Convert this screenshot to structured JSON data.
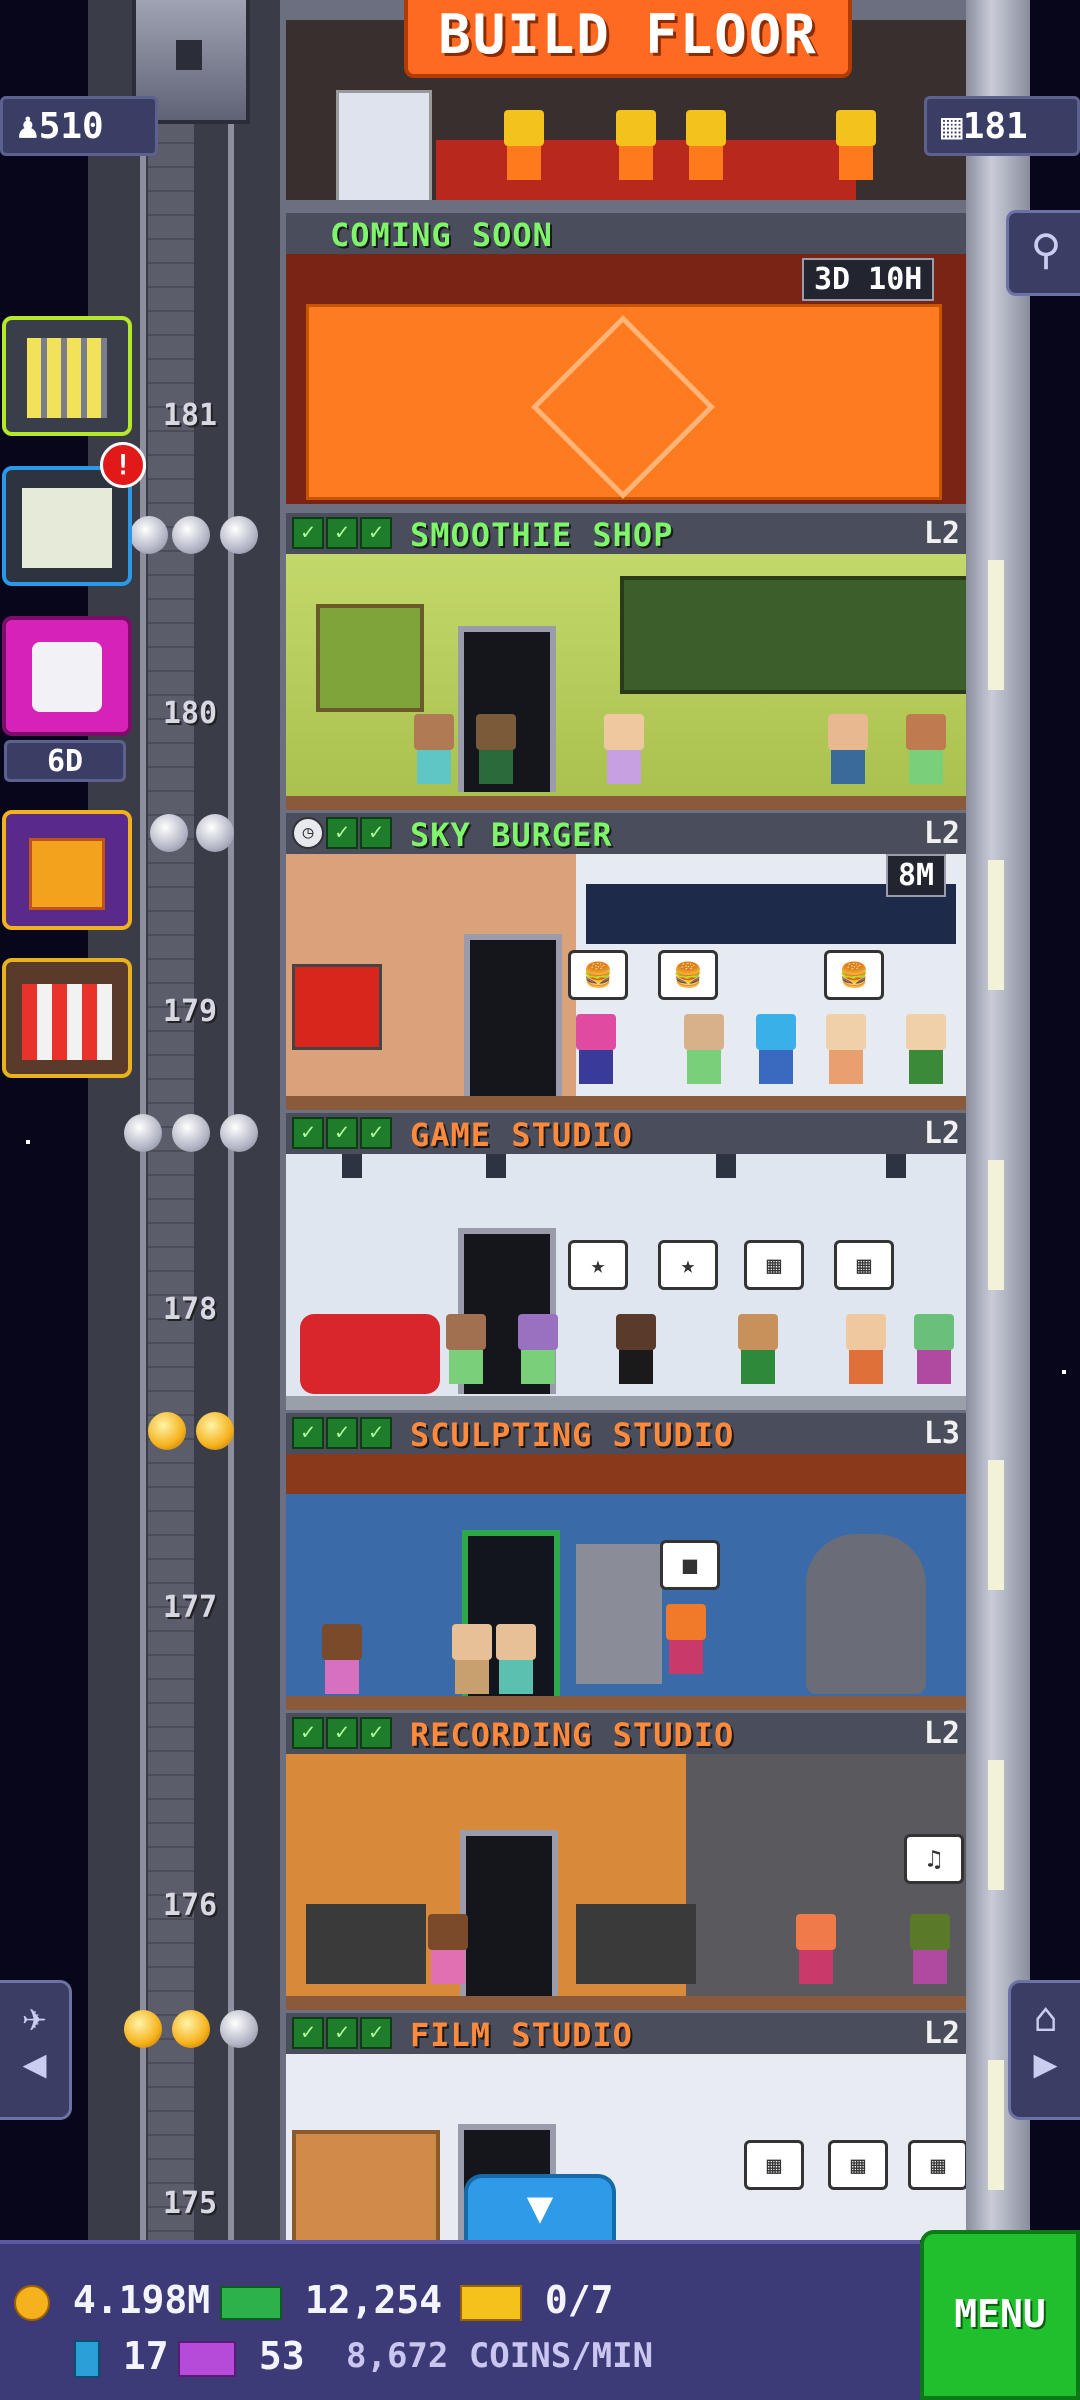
{
  "top": {
    "build_label": "BUILD FLOOR",
    "population": "510",
    "floor_count": "181",
    "coming_soon": "COMING SOON",
    "construction_timer": "3D 10H"
  },
  "side": {
    "dice_timer": "6D"
  },
  "floors": [
    {
      "number": "181",
      "name": "",
      "level": ""
    },
    {
      "number": "180",
      "name": "SMOOTHIE SHOP",
      "level": "L2",
      "color": "green"
    },
    {
      "number": "179",
      "name": "SKY BURGER",
      "level": "L2",
      "color": "green",
      "timer": "8M"
    },
    {
      "number": "178",
      "name": "GAME STUDIO",
      "level": "L2",
      "color": "orange"
    },
    {
      "number": "177",
      "name": "SCULPTING STUDIO",
      "level": "L3",
      "color": "orange"
    },
    {
      "number": "176",
      "name": "RECORDING STUDIO",
      "level": "L2",
      "color": "orange"
    },
    {
      "number": "175",
      "name": "FILM STUDIO",
      "level": "L2",
      "color": "orange"
    }
  ],
  "hud": {
    "coins": "4.198M",
    "bux": "12,254",
    "tickets": "0/7",
    "bits": "17",
    "vip": "53",
    "rate": "8,672 COINS/MIN",
    "menu_label": "MENU"
  },
  "colors": {
    "build_orange": "#ff6a22",
    "label_green": "#7ef56a",
    "label_orange": "#ff8a3c",
    "menu_green": "#1fbf2e",
    "hud_purple": "#3d3a78"
  }
}
